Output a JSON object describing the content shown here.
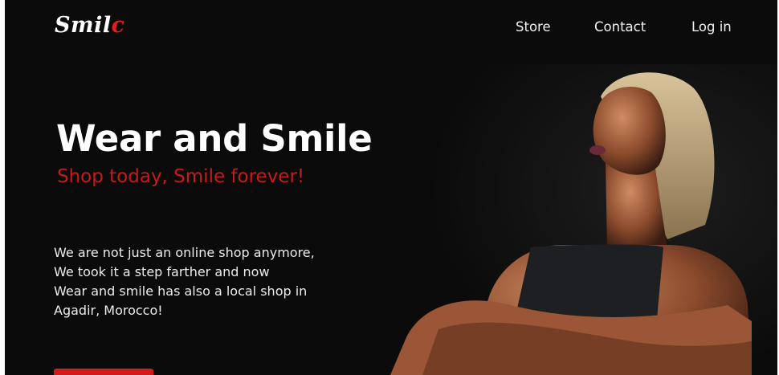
{
  "brand": {
    "logo_main": "Smil",
    "logo_accent": "c",
    "accent_color": "#e11d1d"
  },
  "nav": {
    "items": [
      "Store",
      "Contact",
      "Log in"
    ]
  },
  "hero": {
    "title": "Wear and Smile",
    "subtitle": "Shop today, Smile forever!",
    "description": [
      "We are not just an online shop anymore,",
      "We took it a step farther and now",
      "Wear and smile has also a local shop in",
      "Agadir, Morocco!"
    ],
    "background_color": "#0b0b0b",
    "subtitle_color": "#c81a1a",
    "cta_color": "#d21a1a"
  }
}
